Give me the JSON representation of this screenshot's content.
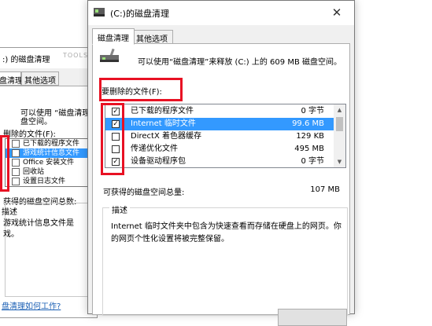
{
  "background_window": {
    "title": ":) 的磁盘清理",
    "watermark": "TOOLS",
    "tabs": [
      "盘清理",
      "其他选项"
    ],
    "intro_line1": "可以使用 “磁盘清理",
    "intro_line2": "盘空间。",
    "files_label": "删除的文件(F):",
    "items": [
      {
        "label": "已下载的程序文件"
      },
      {
        "label": "游戏统计信息文件",
        "selected": true
      },
      {
        "label": "Office 安装文件"
      },
      {
        "label": "回收站"
      },
      {
        "label": "设置日志文件"
      }
    ],
    "total_label": "获得的磁盘空间总数:",
    "desc_legend": "描述",
    "desc_text_line1": "游戏统计信息文件是",
    "desc_text_line2": "戏。",
    "link_text": "盘清理如何工作?"
  },
  "window": {
    "title": "(C:)的磁盘清理",
    "close_glyph": "✕",
    "tabs": {
      "cleanup": "磁盘清理",
      "other": "其他选项"
    },
    "intro": "可以使用“磁盘清理”来释放  (C:) 上的 609 MB 磁盘空间。",
    "files_label": "要删除的文件(F):",
    "files": [
      {
        "name": "已下载的程序文件",
        "size": "0 字节",
        "checked": true,
        "selected": false
      },
      {
        "name": "Internet 临时文件",
        "size": "99.6 MB",
        "checked": true,
        "selected": true
      },
      {
        "name": "DirectX 着色器缓存",
        "size": "129 KB",
        "checked": false,
        "selected": false
      },
      {
        "name": "传递优化文件",
        "size": "495 MB",
        "checked": false,
        "selected": false
      },
      {
        "name": "设备驱动程序包",
        "size": "0 字节",
        "checked": true,
        "selected": false
      }
    ],
    "check_glyph": "✓",
    "total_label": "可获得的磁盘空间总量:",
    "total_value": "107 MB",
    "description_legend": "描述",
    "description_text": "Internet 临时文件夹中包含为快速查看而存储在硬盘上的网页。你的网页个性化设置将被完整保留。",
    "scroll_up": "▲",
    "scroll_down": "▼"
  }
}
